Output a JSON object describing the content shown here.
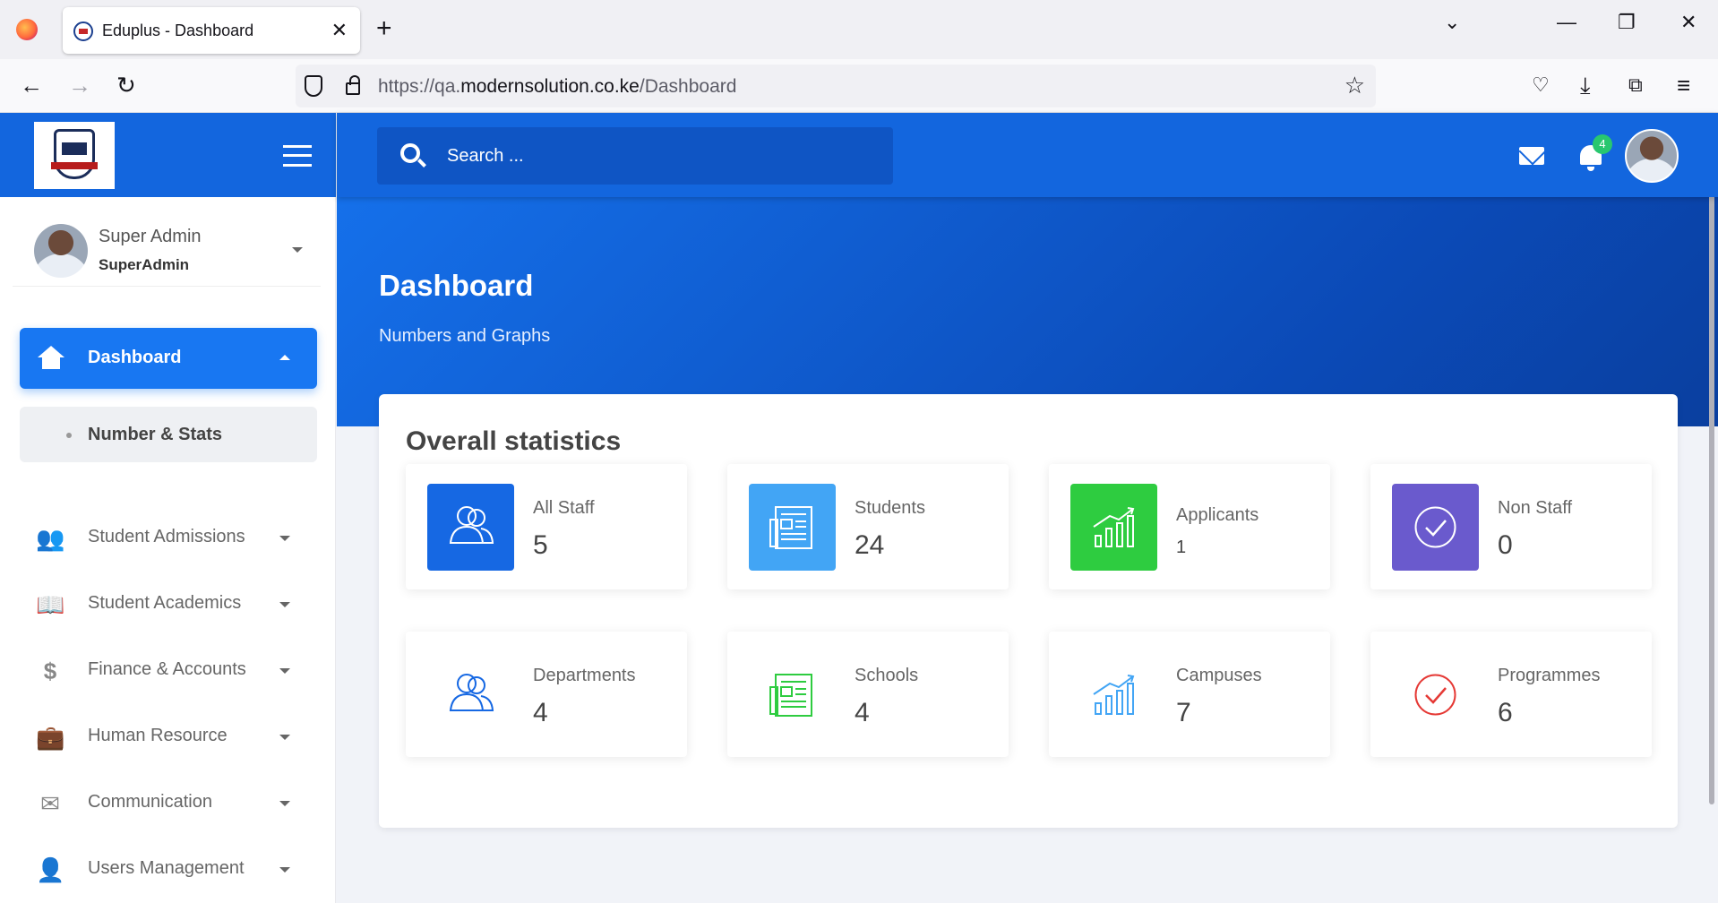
{
  "browser": {
    "tab_title": "Eduplus - Dashboard",
    "url_prefix": "https://qa.",
    "url_domain": "modernsolution.co.ke",
    "url_path": "/Dashboard"
  },
  "sidebar": {
    "user": {
      "name": "Super Admin",
      "role": "SuperAdmin"
    },
    "active_item": {
      "label": "Dashboard",
      "icon": "home-icon"
    },
    "sub_item": {
      "label": "Number & Stats"
    },
    "items": [
      {
        "label": "Student Admissions",
        "icon": "users-icon"
      },
      {
        "label": "Student Academics",
        "icon": "book-icon"
      },
      {
        "label": "Finance & Accounts",
        "icon": "dollar-icon"
      },
      {
        "label": "Human Resource",
        "icon": "briefcase-icon"
      },
      {
        "label": "Communication",
        "icon": "envelope-icon"
      },
      {
        "label": "Users Management",
        "icon": "user-icon"
      }
    ]
  },
  "topbar": {
    "search_placeholder": "Search ...",
    "notification_count": "4"
  },
  "hero": {
    "title": "Dashboard",
    "subtitle": "Numbers and Graphs"
  },
  "stats": {
    "title": "Overall statistics",
    "cards": [
      {
        "label": "All Staff",
        "value": "5",
        "icon": "users-icon",
        "color": "#1668e3"
      },
      {
        "label": "Students",
        "value": "24",
        "icon": "newspaper-icon",
        "color": "#42a5f5"
      },
      {
        "label": "Applicants",
        "value": "1",
        "icon": "chart-icon",
        "color": "#2ecc40"
      },
      {
        "label": "Non Staff",
        "value": "0",
        "icon": "check-circle-icon",
        "color": "#6a5acd"
      },
      {
        "label": "Departments",
        "value": "4",
        "icon": "users-icon",
        "color": "#1668e3"
      },
      {
        "label": "Schools",
        "value": "4",
        "icon": "newspaper-icon",
        "color": "#2ecc40"
      },
      {
        "label": "Campuses",
        "value": "7",
        "icon": "chart-icon",
        "color": "#42a5f5"
      },
      {
        "label": "Programmes",
        "value": "6",
        "icon": "check-circle-icon",
        "color": "#e53935"
      }
    ]
  }
}
